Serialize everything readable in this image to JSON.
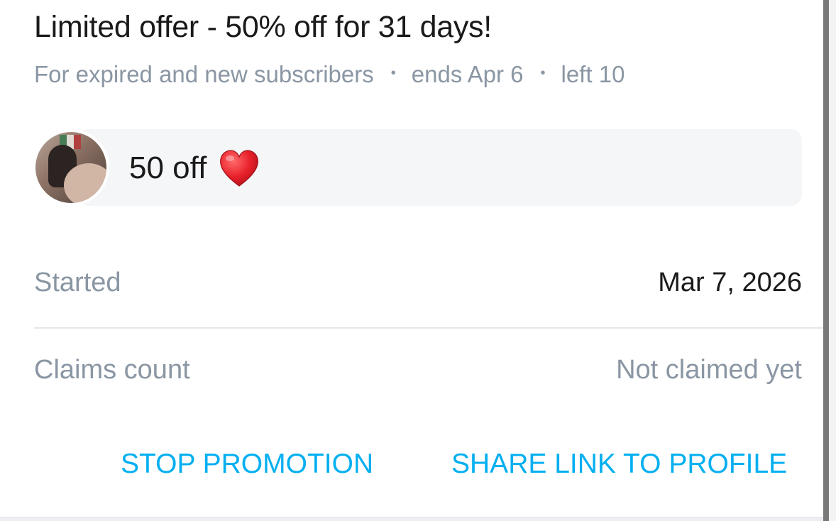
{
  "promotion": {
    "title": "Limited offer - 50% off for 31 days!",
    "audience": "For expired and new subscribers",
    "ends": "ends Apr 6",
    "left": "left 10",
    "separator": "•"
  },
  "message": {
    "text": "50 off",
    "emoji_icon": "red-heart-icon"
  },
  "details": {
    "started_label": "Started",
    "started_value": "Mar 7, 2026",
    "claims_label": "Claims count",
    "claims_value": "Not claimed yet"
  },
  "actions": {
    "stop_label": "STOP PROMOTION",
    "share_label": "SHARE LINK TO PROFILE"
  },
  "colors": {
    "accent": "#00aff0",
    "muted_text": "#8a96a3",
    "primary_text": "#1a1a1a",
    "bubble_bg": "#f5f6f8"
  }
}
